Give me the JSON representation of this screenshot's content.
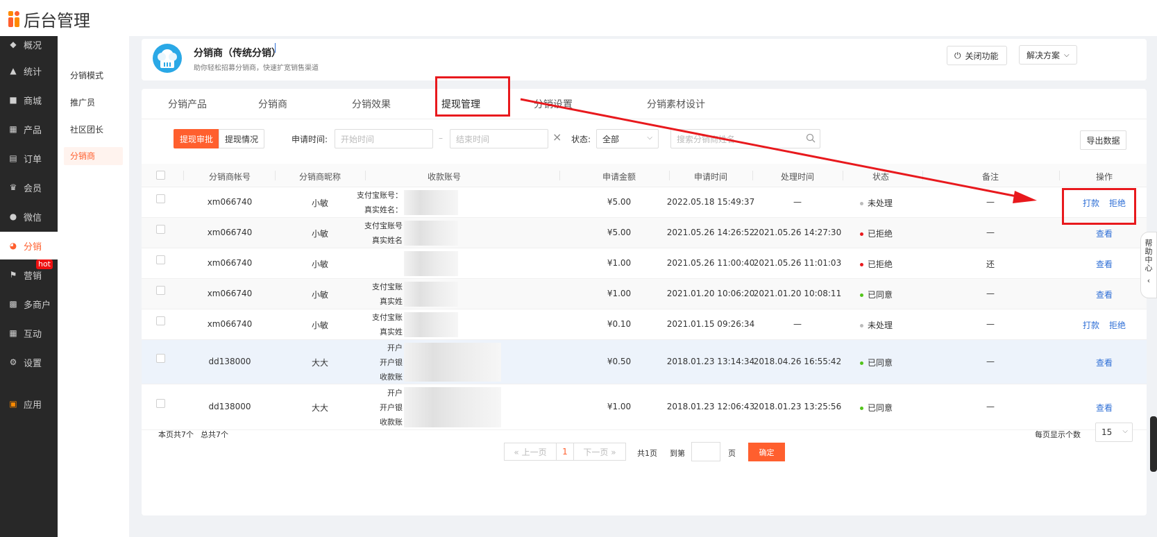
{
  "app": {
    "title": "后台管理"
  },
  "sidebar": {
    "items": [
      {
        "label": "概况",
        "icon": "dashboard-icon"
      },
      {
        "label": "统计",
        "icon": "chart-icon"
      },
      {
        "label": "商城",
        "icon": "shop-icon"
      },
      {
        "label": "产品",
        "icon": "grid-icon"
      },
      {
        "label": "订单",
        "icon": "order-icon"
      },
      {
        "label": "会员",
        "icon": "crown-icon"
      },
      {
        "label": "微信",
        "icon": "wechat-icon"
      },
      {
        "label": "分销",
        "icon": "distribution-icon",
        "active": true
      },
      {
        "label": "营销",
        "icon": "flag-icon"
      },
      {
        "label": "多商户",
        "icon": "merchant-icon"
      },
      {
        "label": "互动",
        "icon": "interact-icon"
      },
      {
        "label": "设置",
        "icon": "gear-icon"
      },
      {
        "label": "应用",
        "icon": "apps-icon"
      }
    ],
    "hot_badge": "hot"
  },
  "subnav": {
    "items": [
      {
        "label": "分销模式"
      },
      {
        "label": "推广员"
      },
      {
        "label": "社区团长"
      },
      {
        "label": "分销商",
        "active": true
      }
    ]
  },
  "header": {
    "title": "分销商（传统分销）",
    "description": "助你轻松招募分销商，快速扩宽销售渠道",
    "close_feature_label": "关闭功能",
    "solution_label": "解决方案"
  },
  "tabs": [
    {
      "label": "分销产品"
    },
    {
      "label": "分销商"
    },
    {
      "label": "分销效果"
    },
    {
      "label": "提现管理",
      "active": true
    },
    {
      "label": "分销设置"
    },
    {
      "label": "分销素材设计"
    }
  ],
  "filters": {
    "seg_review": "提现审批",
    "seg_status": "提现情况",
    "apply_time_label": "申请时间:",
    "start_placeholder": "开始时间",
    "end_placeholder": "结束时间",
    "range_sep": "–",
    "clear_icon": "×",
    "status_label": "状态:",
    "status_value": "全部",
    "search_placeholder": "搜索分销商姓名",
    "export_label": "导出数据"
  },
  "table": {
    "headers": [
      "分销商帐号",
      "分销商昵称",
      "收款账号",
      "申请金额",
      "申请时间",
      "处理时间",
      "状态",
      "备注",
      "操作"
    ],
    "rows": [
      {
        "account": "xm066740",
        "nickname": "小敏",
        "payee": [
          "支付宝账号：",
          "真实姓名："
        ],
        "amount": "¥5.00",
        "apply_time": "2022.05.18 15:49:37",
        "process_time": "—",
        "status": "未处理",
        "status_color": "#bbbbbb",
        "remark": "—",
        "actions": [
          "打款",
          "拒绝"
        ]
      },
      {
        "account": "xm066740",
        "nickname": "小敏",
        "payee": [
          "支付宝账号",
          "真实姓名"
        ],
        "amount": "¥5.00",
        "apply_time": "2021.05.26 14:26:52",
        "process_time": "2021.05.26 14:27:30",
        "status": "已拒绝",
        "status_color": "#e8191d",
        "remark": "—",
        "actions": [
          "查看"
        ]
      },
      {
        "account": "xm066740",
        "nickname": "小敏",
        "payee": [],
        "amount": "¥1.00",
        "apply_time": "2021.05.26 11:00:40",
        "process_time": "2021.05.26 11:01:03",
        "status": "已拒绝",
        "status_color": "#e8191d",
        "remark": "还",
        "actions": [
          "查看"
        ]
      },
      {
        "account": "xm066740",
        "nickname": "小敏",
        "payee": [
          "支付宝账",
          "真实姓"
        ],
        "amount": "¥1.00",
        "apply_time": "2021.01.20 10:06:20",
        "process_time": "2021.01.20 10:08:11",
        "status": "已同意",
        "status_color": "#52c41a",
        "remark": "—",
        "actions": [
          "查看"
        ]
      },
      {
        "account": "xm066740",
        "nickname": "小敏",
        "payee": [
          "支付宝账",
          "真实姓"
        ],
        "amount": "¥0.10",
        "apply_time": "2021.01.15 09:26:34",
        "process_time": "—",
        "status": "未处理",
        "status_color": "#bbbbbb",
        "remark": "—",
        "actions": [
          "打款",
          "拒绝"
        ]
      },
      {
        "account": "dd138000",
        "nickname": "大大",
        "payee": [
          "开户",
          "开户银",
          "收款账"
        ],
        "amount": "¥0.50",
        "apply_time": "2018.01.23 13:14:34",
        "process_time": "2018.04.26 16:55:42",
        "status": "已同意",
        "status_color": "#52c41a",
        "remark": "—",
        "actions": [
          "查看"
        ]
      },
      {
        "account": "dd138000",
        "nickname": "大大",
        "payee": [
          "开户",
          "开户银",
          "收款账"
        ],
        "amount": "¥1.00",
        "apply_time": "2018.01.23 12:06:43",
        "process_time": "2018.01.23 13:25:56",
        "status": "已同意",
        "status_color": "#52c41a",
        "remark": "—",
        "actions": [
          "查看"
        ]
      }
    ]
  },
  "footer": {
    "page_count_text": "本页共7个",
    "total_text": "总共7个",
    "page_size_label": "每页显示个数",
    "page_size_value": "15",
    "prev_label": "« 上一页",
    "current_page": "1",
    "next_label": "下一页 »",
    "total_pages": "共1页",
    "goto_label": "到第",
    "page_unit": "页",
    "confirm_label": "确定"
  },
  "help": {
    "label": "帮助中心"
  },
  "colors": {
    "accent": "#ff5f2e",
    "annotation": "#e8191d",
    "link": "#2f6fd6"
  }
}
